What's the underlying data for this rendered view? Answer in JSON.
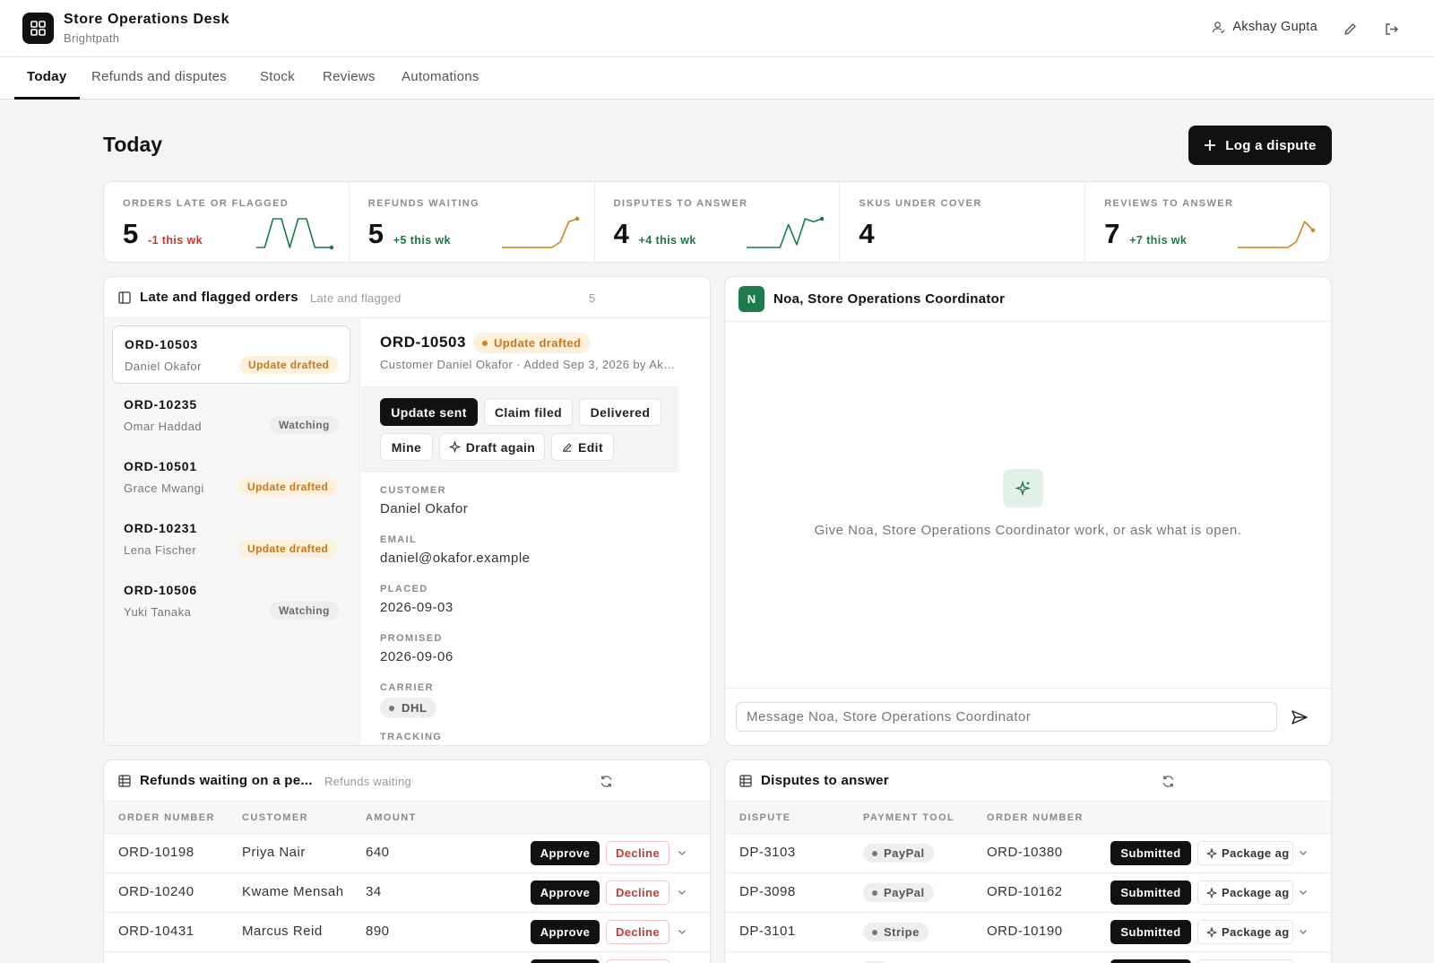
{
  "app": {
    "title": "Store Operations Desk",
    "subtitle": "Brightpath"
  },
  "user": {
    "name": "Akshay Gupta"
  },
  "tabs": [
    "Today",
    "Refunds and disputes",
    "Stock",
    "Reviews",
    "Automations"
  ],
  "page": {
    "title": "Today",
    "primary_action": "Log a dispute"
  },
  "kpis": [
    {
      "label": "ORDERS LATE OR FLAGGED",
      "value": "5",
      "delta": "-1 this wk",
      "delta_color": "#c0392b",
      "spark_color": "#1a7a44",
      "spark": [
        0,
        0,
        1,
        1,
        0,
        1,
        1,
        0,
        0,
        0
      ]
    },
    {
      "label": "REFUNDS WAITING",
      "value": "5",
      "delta": "+5 this wk",
      "delta_color": "#1a7a44",
      "spark_color": "#d5801c",
      "spark": [
        0,
        0,
        0,
        0,
        0,
        0,
        0,
        0.2,
        0.9,
        1
      ]
    },
    {
      "label": "DISPUTES TO ANSWER",
      "value": "4",
      "delta": "+4 this wk",
      "delta_color": "#1a7a44",
      "spark_color": "#1a7a44",
      "spark": [
        0,
        0,
        0,
        0,
        0,
        0.8,
        0.1,
        1,
        0.9,
        1
      ]
    },
    {
      "label": "SKUS UNDER COVER",
      "value": "4",
      "delta": "",
      "delta_color": "#1a7a44",
      "spark_color": "#1a7a44",
      "spark": []
    },
    {
      "label": "REVIEWS TO ANSWER",
      "value": "7",
      "delta": "+7 this wk",
      "delta_color": "#1a7a44",
      "spark_color": "#d5801c",
      "spark": [
        0,
        0,
        0,
        0,
        0,
        0,
        0,
        0.2,
        0.9,
        0.6
      ]
    }
  ],
  "orders_panel": {
    "title": "Late and flagged orders",
    "subtitle": "Late and flagged",
    "count": "5",
    "items": [
      {
        "id": "ORD-10503",
        "name": "Daniel Okafor",
        "status": "Update drafted"
      },
      {
        "id": "ORD-10235",
        "name": "Omar Haddad",
        "status": "Watching"
      },
      {
        "id": "ORD-10501",
        "name": "Grace Mwangi",
        "status": "Update drafted"
      },
      {
        "id": "ORD-10231",
        "name": "Lena Fischer",
        "status": "Update drafted"
      },
      {
        "id": "ORD-10506",
        "name": "Yuki Tanaka",
        "status": "Watching"
      }
    ],
    "detail": {
      "id": "ORD-10503",
      "status": "Update drafted",
      "meta": "Customer Daniel Okafor  ·  Added Sep 3, 2026 by Ak…",
      "actions": [
        "Update sent",
        "Claim filed",
        "Delivered",
        "Mine",
        "Draft again",
        "Edit"
      ],
      "fields": [
        {
          "label": "CUSTOMER",
          "value": "Daniel Okafor"
        },
        {
          "label": "EMAIL",
          "value": "daniel@okafor.example"
        },
        {
          "label": "PLACED",
          "value": "2026-09-03"
        },
        {
          "label": "PROMISED",
          "value": "2026-09-06"
        },
        {
          "label": "CARRIER",
          "value": "DHL"
        },
        {
          "label": "TRACKING",
          "value": ""
        }
      ]
    }
  },
  "chat": {
    "title": "Noa, Store Operations Coordinator",
    "avatar": "N",
    "empty_text": "Give Noa, Store Operations Coordinator work, or ask what is open.",
    "placeholder": "Message Noa, Store Operations Coordinator"
  },
  "refunds": {
    "title": "Refunds waiting on a pe...",
    "subtitle": "Refunds waiting",
    "columns": [
      "ORDER NUMBER",
      "CUSTOMER",
      "AMOUNT"
    ],
    "approve_label": "Approve",
    "decline_label": "Decline",
    "rows": [
      {
        "order": "ORD-10198",
        "customer": "Priya Nair",
        "amount": "640"
      },
      {
        "order": "ORD-10240",
        "customer": "Kwame Mensah",
        "amount": "34"
      },
      {
        "order": "ORD-10431",
        "customer": "Marcus Reid",
        "amount": "890"
      }
    ]
  },
  "disputes": {
    "title": "Disputes to answer",
    "columns": [
      "DISPUTE",
      "PAYMENT TOOL",
      "ORDER NUMBER"
    ],
    "submit_label": "Submitted",
    "draft_label": "Package ag",
    "rows": [
      {
        "dispute": "DP-3103",
        "tool": "PayPal",
        "order": "ORD-10380"
      },
      {
        "dispute": "DP-3098",
        "tool": "PayPal",
        "order": "ORD-10162"
      },
      {
        "dispute": "DP-3101",
        "tool": "Stripe",
        "order": "ORD-10190"
      }
    ]
  }
}
